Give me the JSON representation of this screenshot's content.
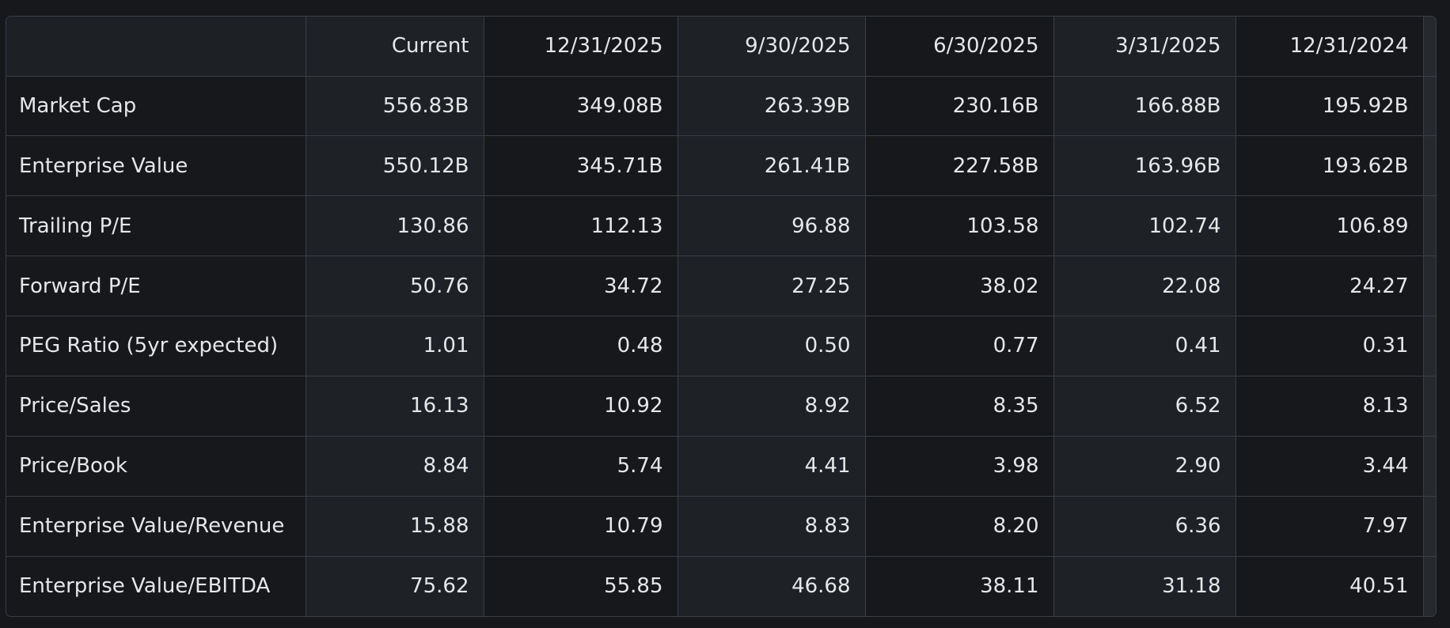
{
  "table": {
    "columns": [
      "Current",
      "12/31/2025",
      "9/30/2025",
      "6/30/2025",
      "3/31/2025",
      "12/31/2024"
    ],
    "rows": [
      {
        "label": "Market Cap",
        "values": [
          "556.83B",
          "349.08B",
          "263.39B",
          "230.16B",
          "166.88B",
          "195.92B"
        ]
      },
      {
        "label": "Enterprise Value",
        "values": [
          "550.12B",
          "345.71B",
          "261.41B",
          "227.58B",
          "163.96B",
          "193.62B"
        ]
      },
      {
        "label": "Trailing P/E",
        "values": [
          "130.86",
          "112.13",
          "96.88",
          "103.58",
          "102.74",
          "106.89"
        ]
      },
      {
        "label": "Forward P/E",
        "values": [
          "50.76",
          "34.72",
          "27.25",
          "38.02",
          "22.08",
          "24.27"
        ]
      },
      {
        "label": "PEG Ratio (5yr expected)",
        "values": [
          "1.01",
          "0.48",
          "0.50",
          "0.77",
          "0.41",
          "0.31"
        ]
      },
      {
        "label": "Price/Sales",
        "values": [
          "16.13",
          "10.92",
          "8.92",
          "8.35",
          "6.52",
          "8.13"
        ]
      },
      {
        "label": "Price/Book",
        "values": [
          "8.84",
          "5.74",
          "4.41",
          "3.98",
          "2.90",
          "3.44"
        ]
      },
      {
        "label": "Enterprise Value/Revenue",
        "values": [
          "15.88",
          "10.79",
          "8.83",
          "8.20",
          "6.36",
          "7.97"
        ]
      },
      {
        "label": "Enterprise Value/EBITDA",
        "values": [
          "75.62",
          "55.85",
          "46.68",
          "38.11",
          "31.18",
          "40.51"
        ]
      }
    ]
  }
}
